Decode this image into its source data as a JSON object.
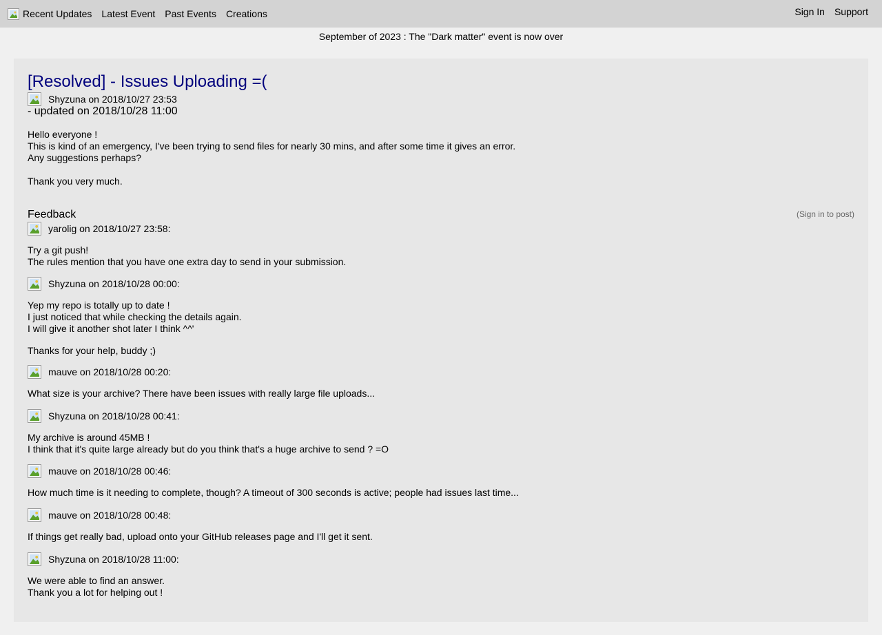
{
  "nav": {
    "items": [
      "Recent Updates",
      "Latest Event",
      "Past Events",
      "Creations"
    ],
    "right_items": [
      "Sign In",
      "Support"
    ]
  },
  "announcement": "September of 2023 : The \"Dark matter\" event is now over",
  "post": {
    "title": "[Resolved] - Issues Uploading =(",
    "byline": "Shyzuna on 2018/10/27 23:53",
    "updated": "- updated on 2018/10/28 11:00",
    "body": [
      "Hello everyone !",
      "This is kind of an emergency, I've been trying to send files for nearly 30 mins, and after some time it gives an error.",
      "Any suggestions perhaps?",
      "",
      "Thank you very much."
    ]
  },
  "feedback": {
    "heading": "Feedback",
    "signin_note": "(Sign in to post)",
    "comments": [
      {
        "byline": "yarolig on 2018/10/27 23:58:",
        "lines": [
          "Try a git push!",
          "The rules mention that you have one extra day to send in your submission."
        ]
      },
      {
        "byline": "Shyzuna on 2018/10/28 00:00:",
        "lines": [
          "Yep my repo is totally up to date !",
          "I just noticed that while checking the details again.",
          "I will give it another shot later I think ^^'",
          "",
          "Thanks for your help, buddy ;)"
        ]
      },
      {
        "byline": "mauve on 2018/10/28 00:20:",
        "lines": [
          "What size is your archive? There have been issues with really large file uploads..."
        ]
      },
      {
        "byline": "Shyzuna on 2018/10/28 00:41:",
        "lines": [
          "My archive is around 45MB !",
          "I think that it's quite large already but do you think that's a huge archive to send ? =O"
        ]
      },
      {
        "byline": "mauve on 2018/10/28 00:46:",
        "lines": [
          "How much time is it needing to complete, though? A timeout of 300 seconds is active; people had issues last time..."
        ]
      },
      {
        "byline": "mauve on 2018/10/28 00:48:",
        "lines": [
          "If things get really bad, upload onto your GitHub releases page and I'll get it sent."
        ]
      },
      {
        "byline": "Shyzuna on 2018/10/28 11:00:",
        "lines": [
          "We were able to find an answer.",
          "Thank you a lot for helping out !"
        ]
      }
    ]
  }
}
